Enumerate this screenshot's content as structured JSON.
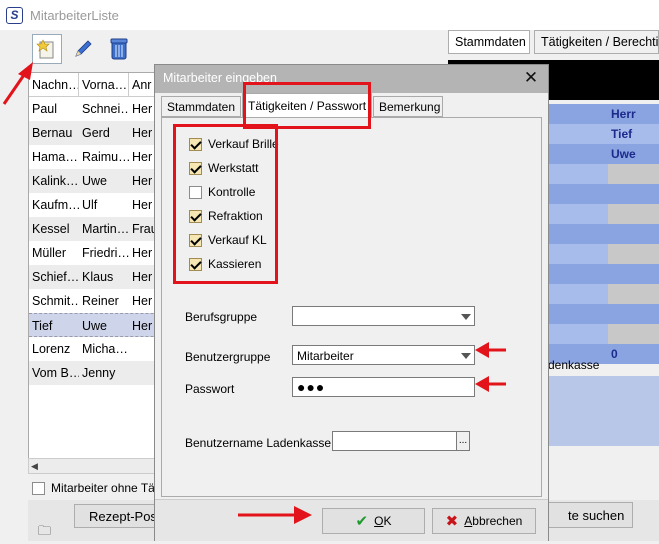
{
  "main": {
    "title": "MitarbeiterListe",
    "list_headers": [
      "Nachn…",
      "Vorna…",
      "Anr"
    ],
    "rows": [
      {
        "nachname": "Paul",
        "vorname": "Schnei…",
        "anrede": "Her"
      },
      {
        "nachname": "Bernau",
        "vorname": "Gerd",
        "anrede": "Her"
      },
      {
        "nachname": "Hama…",
        "vorname": "Raimu…",
        "anrede": "Her"
      },
      {
        "nachname": "Kalink…",
        "vorname": "Uwe",
        "anrede": "Her"
      },
      {
        "nachname": "Kaufm…",
        "vorname": "Ulf",
        "anrede": "Her"
      },
      {
        "nachname": "Kessel",
        "vorname": "Martin…",
        "anrede": "Frau"
      },
      {
        "nachname": "Müller",
        "vorname": "Friedri…",
        "anrede": "Her"
      },
      {
        "nachname": "Schief…",
        "vorname": "Klaus",
        "anrede": "Her"
      },
      {
        "nachname": "Schmit…",
        "vorname": "Reiner",
        "anrede": "Her"
      },
      {
        "nachname": "Tief",
        "vorname": "Uwe",
        "anrede": "Her"
      },
      {
        "nachname": "Lorenz",
        "vorname": "Micha…",
        "anrede": ""
      },
      {
        "nachname": "Vom B…",
        "vorname": "Jenny",
        "anrede": ""
      }
    ],
    "ohne_label": "Mitarbeiter ohne Tä",
    "rezept_label": "Rezept-Pos",
    "suchen_label": "te suchen",
    "right_tabs": [
      "Stammdaten",
      "Tätigkeiten / Berechtig"
    ],
    "right_values": [
      "Herr",
      "Tief",
      "Uwe",
      "0"
    ],
    "right_ladenkasse": "denkasse"
  },
  "dialog": {
    "title": "Mitarbeiter eingeben",
    "tabs": [
      "Stammdaten",
      "Tätigkeiten / Passwort",
      "Bemerkung"
    ],
    "permissions": [
      {
        "label": "Verkauf Brille",
        "checked": true
      },
      {
        "label": "Werkstatt",
        "checked": true
      },
      {
        "label": "Kontrolle",
        "checked": false
      },
      {
        "label": "Refraktion",
        "checked": true
      },
      {
        "label": "Verkauf KL",
        "checked": true
      },
      {
        "label": "Kassieren",
        "checked": true
      }
    ],
    "berufsgruppe_label": "Berufsgruppe",
    "berufsgruppe_value": "",
    "benutzergruppe_label": "Benutzergruppe",
    "benutzergruppe_value": "Mitarbeiter",
    "passwort_label": "Passwort",
    "passwort_value": "●●●",
    "ladenkasse_label": "Benutzername Ladenkasse",
    "ladenkasse_value": "",
    "browse_label": "...",
    "ok_hotkey": "O",
    "ok_rest": "K",
    "cancel_hotkey": "A",
    "cancel_rest": "bbrechen"
  },
  "colors": {
    "annotation": "#e2131a",
    "selection": "#ced4ea",
    "grid_blue": "#8aa4e2"
  }
}
